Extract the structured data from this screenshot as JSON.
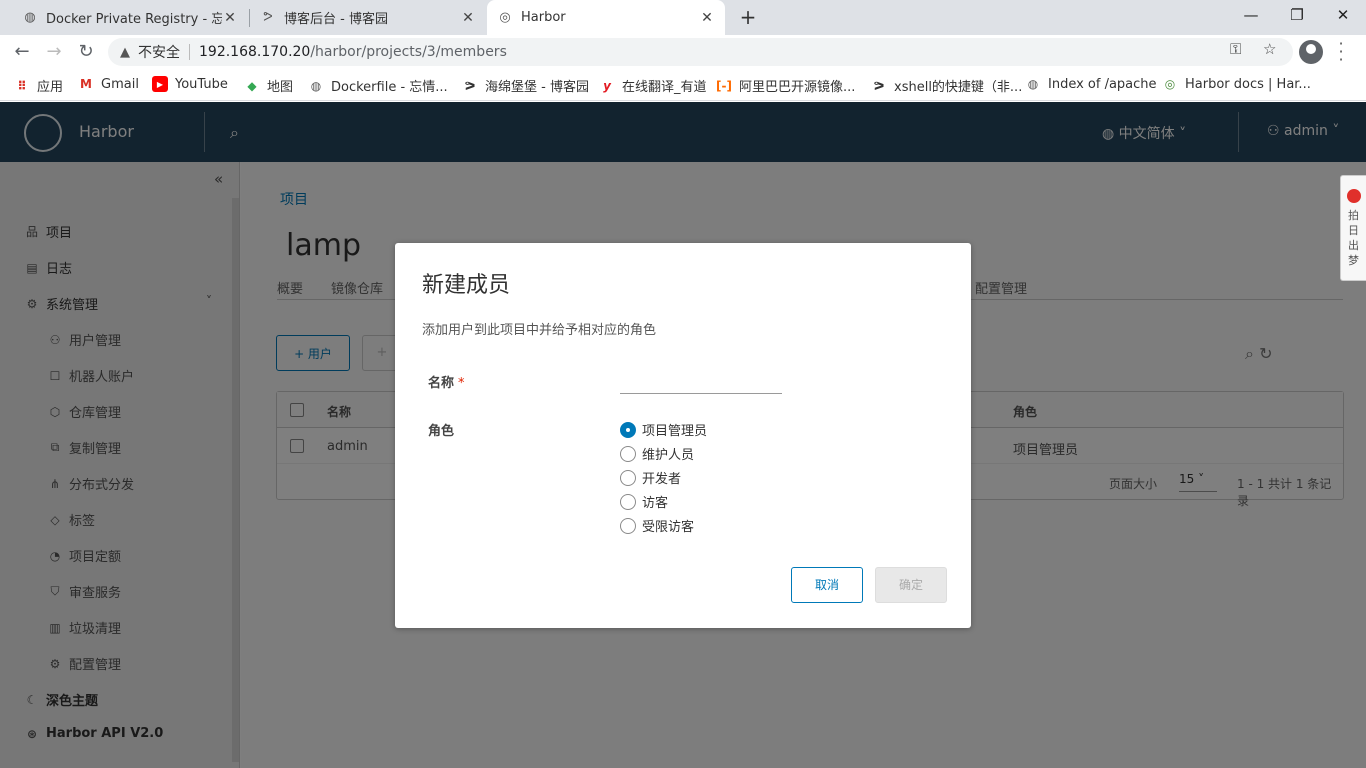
{
  "browser": {
    "tabs": [
      {
        "title": "Docker Private Registry - 忘情",
        "icon": "globe-icon"
      },
      {
        "title": "博客后台 - 博客园",
        "icon": "cnblogs-icon"
      },
      {
        "title": "Harbor",
        "icon": "harbor-icon"
      }
    ],
    "security_label": "不安全",
    "url_host": "192.168.170.20",
    "url_path": "/harbor/projects/3/members",
    "bookmarks": [
      {
        "label": "应用",
        "icon": "apps-grid-icon"
      },
      {
        "label": "Gmail",
        "icon": "gmail-icon"
      },
      {
        "label": "YouTube",
        "icon": "youtube-icon"
      },
      {
        "label": "地图",
        "icon": "maps-icon"
      },
      {
        "label": "Dockerfile - 忘情...",
        "icon": "globe-icon"
      },
      {
        "label": "海绵堡堡 - 博客园",
        "icon": "cnblogs-icon"
      },
      {
        "label": "在线翻译_有道",
        "icon": "youdao-icon"
      },
      {
        "label": "阿里巴巴开源镜像...",
        "icon": "aliyun-icon"
      },
      {
        "label": "xshell的快捷键（非...",
        "icon": "cnblogs-icon"
      },
      {
        "label": "Index of /apache",
        "icon": "globe-icon"
      },
      {
        "label": "Harbor docs | Har...",
        "icon": "harbor-icon"
      }
    ]
  },
  "header": {
    "app_name": "Harbor",
    "language": "中文简体",
    "user": "admin"
  },
  "sidebar": {
    "items": [
      {
        "label": "项目",
        "icon": "project-icon"
      },
      {
        "label": "日志",
        "icon": "log-icon"
      },
      {
        "label": "系统管理",
        "icon": "admin-icon"
      },
      {
        "label": "用户管理",
        "icon": "users-icon"
      },
      {
        "label": "机器人账户",
        "icon": "robot-icon"
      },
      {
        "label": "仓库管理",
        "icon": "registry-icon"
      },
      {
        "label": "复制管理",
        "icon": "replication-icon"
      },
      {
        "label": "分布式分发",
        "icon": "distribution-icon"
      },
      {
        "label": "标签",
        "icon": "tag-icon"
      },
      {
        "label": "项目定额",
        "icon": "quota-icon"
      },
      {
        "label": "审查服务",
        "icon": "shield-icon"
      },
      {
        "label": "垃圾清理",
        "icon": "trash-icon"
      },
      {
        "label": "配置管理",
        "icon": "gear-icon"
      },
      {
        "label": "深色主题",
        "icon": "moon-icon"
      },
      {
        "label": "Harbor API V2.0",
        "icon": "api-icon"
      }
    ]
  },
  "main": {
    "breadcrumb": "项目",
    "project_name": "lamp",
    "tabs": [
      "概要",
      "镜像仓库",
      "配置管理"
    ],
    "add_user_label": "+ 用户",
    "grid": {
      "columns": [
        "名称",
        "角色"
      ],
      "rows": [
        {
          "name": "admin",
          "role": "项目管理员"
        }
      ],
      "page_size_label": "页面大小",
      "page_size": "15",
      "summary": "1 - 1 共计 1 条记录"
    }
  },
  "side_widget_text": "拍日出梦",
  "modal": {
    "title": "新建成员",
    "description": "添加用户到此项目中并给予相对应的角色",
    "name_label": "名称",
    "name_required": "*",
    "name_value": "",
    "role_label": "角色",
    "roles": [
      {
        "label": "项目管理员",
        "selected": true
      },
      {
        "label": "维护人员",
        "selected": false
      },
      {
        "label": "开发者",
        "selected": false
      },
      {
        "label": "访客",
        "selected": false
      },
      {
        "label": "受限访客",
        "selected": false
      }
    ],
    "cancel_label": "取消",
    "ok_label": "确定"
  },
  "colors": {
    "header_bg": "#25475e",
    "accent": "#0079b8",
    "required": "#e12200"
  }
}
